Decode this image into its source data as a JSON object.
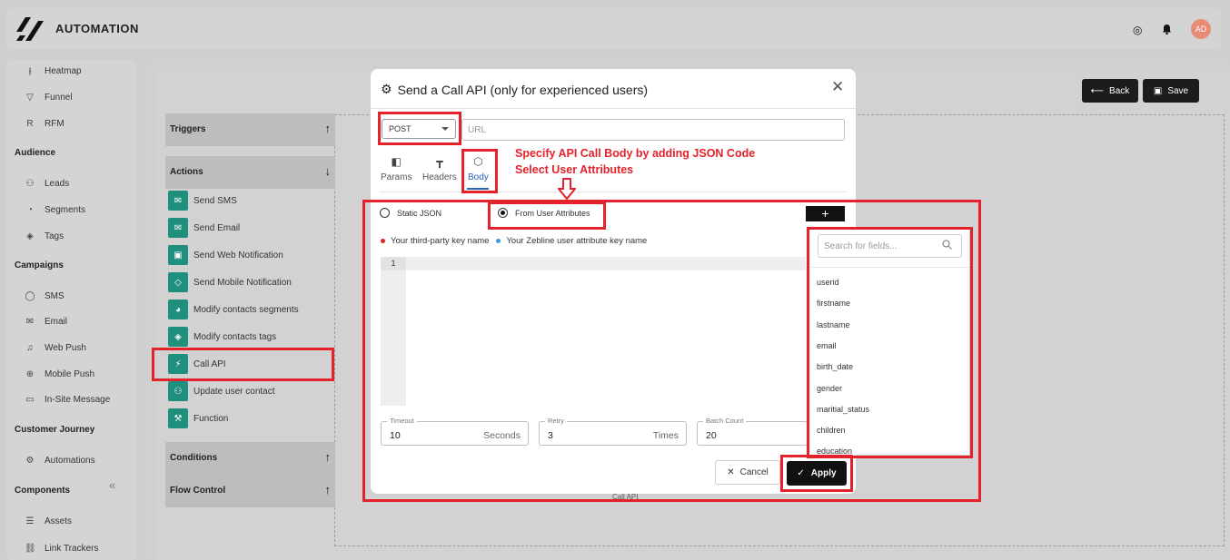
{
  "app": {
    "title": "AUTOMATION",
    "avatar": "AD"
  },
  "nav": {
    "items_top": [
      {
        "label": "Heatmap",
        "icon": "heatmap-icon",
        "glyph": "⫲"
      },
      {
        "label": "Funnel",
        "icon": "funnel-icon",
        "glyph": "▽"
      },
      {
        "label": "RFM",
        "icon": "rfm-icon",
        "glyph": "R"
      }
    ],
    "audience": {
      "title": "Audience",
      "items": [
        {
          "label": "Leads",
          "icon": "leads-icon",
          "glyph": "⚇"
        },
        {
          "label": "Segments",
          "icon": "segments-icon",
          "glyph": "◔"
        },
        {
          "label": "Tags",
          "icon": "tags-icon",
          "glyph": "◈"
        }
      ]
    },
    "campaigns": {
      "title": "Campaigns",
      "items": [
        {
          "label": "SMS",
          "icon": "sms-icon",
          "glyph": "◯"
        },
        {
          "label": "Email",
          "icon": "email-icon",
          "glyph": "✉"
        },
        {
          "label": "Web Push",
          "icon": "web-push-icon",
          "glyph": "♫"
        },
        {
          "label": "Mobile Push",
          "icon": "mobile-push-icon",
          "glyph": "⊕"
        },
        {
          "label": "In-Site Message",
          "icon": "in-site-message-icon",
          "glyph": "▭"
        }
      ]
    },
    "journey": {
      "title": "Customer Journey",
      "items": [
        {
          "label": "Automations",
          "icon": "automations-icon",
          "glyph": "⚙"
        }
      ]
    },
    "components": {
      "title": "Components",
      "items": [
        {
          "label": "Assets",
          "icon": "assets-icon",
          "glyph": "☰"
        },
        {
          "label": "Link Trackers",
          "icon": "link-trackers-icon",
          "glyph": "⛓"
        }
      ]
    }
  },
  "panel": {
    "triggers": "Triggers",
    "actions": "Actions",
    "conditions": "Conditions",
    "flow_control": "Flow Control",
    "action_items": [
      {
        "label": "Send SMS",
        "icon": "send-sms-icon",
        "glyph": "✉"
      },
      {
        "label": "Send Email",
        "icon": "send-email-icon",
        "glyph": "✉"
      },
      {
        "label": "Send Web Notification",
        "icon": "web-notification-icon",
        "glyph": "▣"
      },
      {
        "label": "Send Mobile Notification",
        "icon": "mobile-notification-icon",
        "glyph": "◇"
      },
      {
        "label": "Modify contacts segments",
        "icon": "segments-pie-icon",
        "glyph": "◕"
      },
      {
        "label": "Modify contacts tags",
        "icon": "tag-icon",
        "glyph": "◈"
      },
      {
        "label": "Call API",
        "icon": "call-api-icon",
        "glyph": "⚡"
      },
      {
        "label": "Update user contact",
        "icon": "user-contact-icon",
        "glyph": "⚇"
      },
      {
        "label": "Function",
        "icon": "function-icon",
        "glyph": "⚒"
      }
    ]
  },
  "toolbar": {
    "back": "Back",
    "save": "Save"
  },
  "modal": {
    "title": "Send a Call API (only for experienced users)",
    "method": "POST",
    "url_placeholder": "URL",
    "tabs": {
      "params": "Params",
      "headers": "Headers",
      "body": "Body"
    },
    "annotation_1": "Specify API Call Body by adding JSON Code",
    "annotation_2": "Select User Attributes",
    "radio_static": "Static JSON",
    "radio_attrs": "From User Attributes",
    "legend_third_party": "Your third-party key name",
    "legend_zebline": "Your Zebline user attribute key name",
    "line_number": "1",
    "timeout": {
      "label": "Timeout",
      "value": "10",
      "unit": "Seconds"
    },
    "retry": {
      "label": "Retry",
      "value": "3",
      "unit": "Times"
    },
    "batch": {
      "label": "Batch Count",
      "value": "20"
    },
    "cancel": "Cancel",
    "apply": "Apply"
  },
  "attributes": {
    "search_placeholder": "Search for fields...",
    "items": [
      "userid",
      "firstname",
      "lastname",
      "email",
      "birth_date",
      "gender",
      "maritial_status",
      "children",
      "education"
    ]
  },
  "canvas": {
    "node_label": "Call API"
  },
  "colors": {
    "accent_red": "#e3222b",
    "teal": "#1f8f7e",
    "tab_blue": "#2563b8",
    "third_party_dot": "#e3222b",
    "zebline_dot": "#3b9ae1"
  }
}
